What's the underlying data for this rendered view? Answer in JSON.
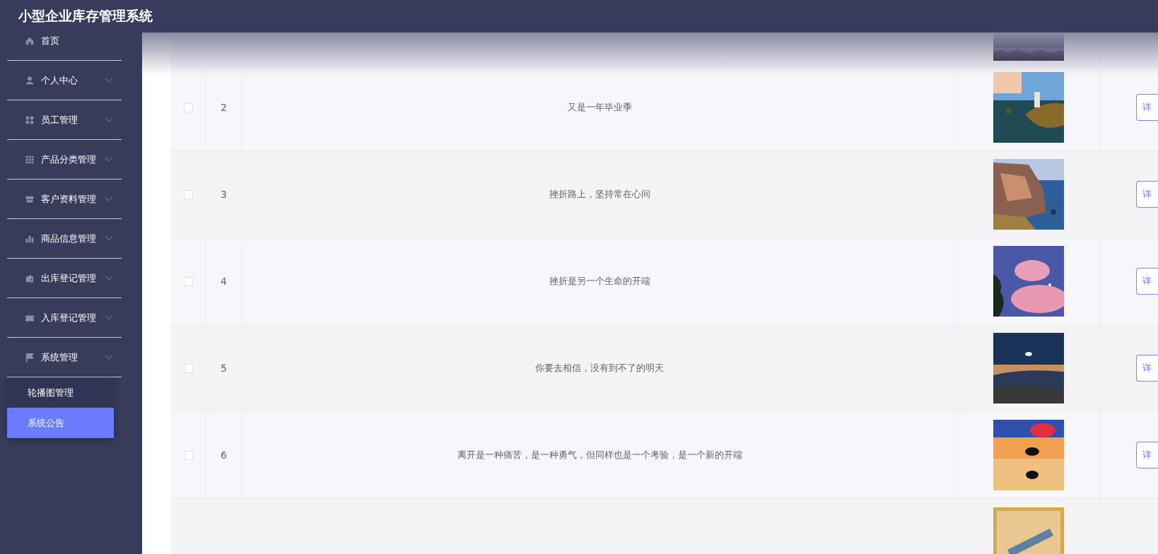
{
  "header": {
    "title": "小型企业库存管理系统"
  },
  "sidebar": {
    "items": [
      {
        "label": "首页",
        "kind": "link"
      },
      {
        "label": "个人中心",
        "kind": "submenu"
      },
      {
        "label": "员工管理",
        "kind": "submenu"
      },
      {
        "label": "产品分类管理",
        "kind": "submenu"
      },
      {
        "label": "客户资料管理",
        "kind": "submenu"
      },
      {
        "label": "商品信息管理",
        "kind": "submenu"
      },
      {
        "label": "出库登记管理",
        "kind": "submenu"
      },
      {
        "label": "入库登记管理",
        "kind": "submenu"
      },
      {
        "label": "系统管理",
        "kind": "submenu",
        "expanded": true,
        "children": [
          {
            "label": "轮播图管理",
            "selected": false
          },
          {
            "label": "系统公告",
            "selected": true
          }
        ]
      }
    ]
  },
  "table": {
    "rows": [
      {
        "checked": false,
        "index": "2",
        "title": "又是一年毕业季",
        "action": "详"
      },
      {
        "checked": false,
        "index": "3",
        "title": "挫折路上，坚持常在心间",
        "action": "详"
      },
      {
        "checked": false,
        "index": "4",
        "title": "挫折是另一个生命的开端",
        "action": "详"
      },
      {
        "checked": false,
        "index": "5",
        "title": "你要去相信，没有到不了的明天",
        "action": "详"
      },
      {
        "checked": false,
        "index": "6",
        "title": "离开是一种痛苦，是一种勇气，但同样也是一个考验，是一个新的开端",
        "action": "详"
      }
    ]
  }
}
